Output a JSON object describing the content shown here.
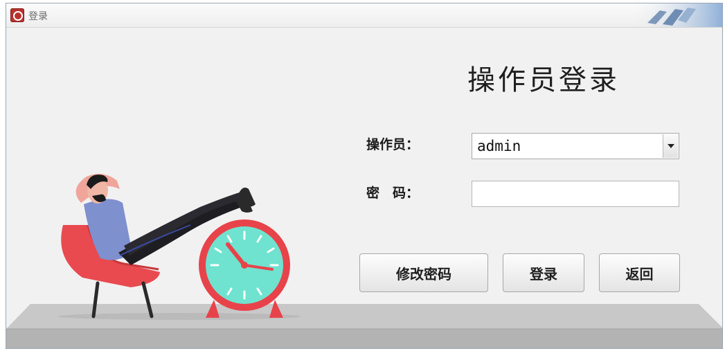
{
  "window": {
    "title": "登录"
  },
  "form": {
    "heading": "操作员登录",
    "operator_label": "操作员：",
    "operator_value": "admin",
    "password_label": "密　码：",
    "password_value": ""
  },
  "buttons": {
    "change_password": "修改密码",
    "login": "登录",
    "back": "返回"
  },
  "icons": {
    "app": "app-logo-icon",
    "dropdown": "chevron-down-icon"
  },
  "colors": {
    "chair": "#e84a4f",
    "clock_face": "#6fe3cf",
    "clock_ring": "#e8434a",
    "shirt": "#7f90cf",
    "pants": "#1e1e22",
    "floor_top": "#c9c9c9",
    "floor_front": "#b2b2b2"
  }
}
